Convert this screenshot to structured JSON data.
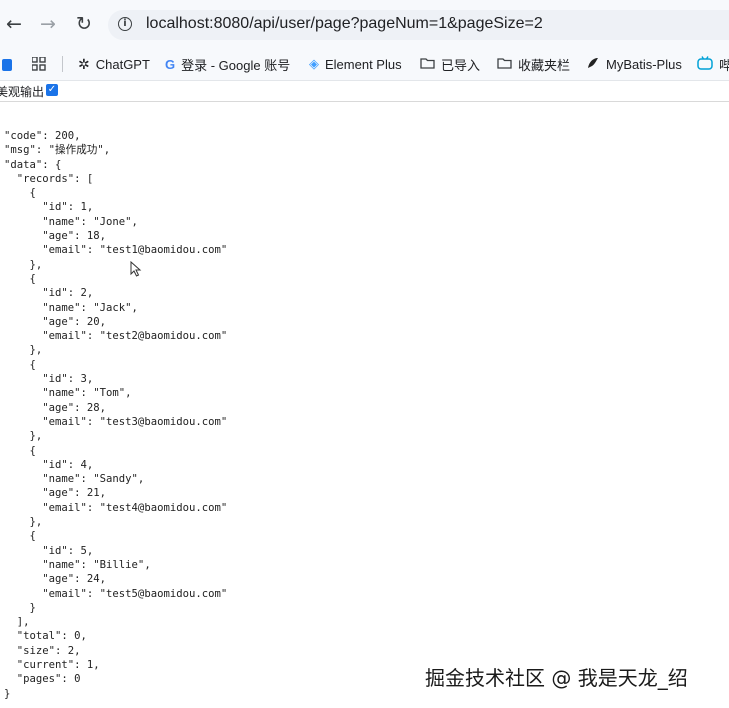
{
  "browser": {
    "url": "localhost:8080/api/user/page?pageNum=1&pageSize=2",
    "back_icon": "←",
    "forward_icon": "→",
    "reload_icon": "↻",
    "info_icon": "i"
  },
  "bookmarks": [
    {
      "label": "ChatGPT",
      "icon": "✲"
    },
    {
      "label": "登录 - Google 账号",
      "icon": "G"
    },
    {
      "label": "Element Plus",
      "icon": "◈"
    },
    {
      "label": "已导入",
      "icon": "folder"
    },
    {
      "label": "收藏夹栏",
      "icon": "folder"
    },
    {
      "label": "MyBatis-Plus",
      "icon": "bird"
    },
    {
      "label": "哔",
      "icon": "tv"
    }
  ],
  "pretty_print": {
    "label": "美观输出",
    "checked": "✓"
  },
  "json_lines": [
    "\"code\": 200,",
    "\"msg\": \"操作成功\",",
    "\"data\": {",
    "  \"records\": [",
    "    {",
    "      \"id\": 1,",
    "      \"name\": \"Jone\",",
    "      \"age\": 18,",
    "      \"email\": \"test1@baomidou.com\"",
    "    },",
    "    {",
    "      \"id\": 2,",
    "      \"name\": \"Jack\",",
    "      \"age\": 20,",
    "      \"email\": \"test2@baomidou.com\"",
    "    },",
    "    {",
    "      \"id\": 3,",
    "      \"name\": \"Tom\",",
    "      \"age\": 28,",
    "      \"email\": \"test3@baomidou.com\"",
    "    },",
    "    {",
    "      \"id\": 4,",
    "      \"name\": \"Sandy\",",
    "      \"age\": 21,",
    "      \"email\": \"test4@baomidou.com\"",
    "    },",
    "    {",
    "      \"id\": 5,",
    "      \"name\": \"Billie\",",
    "      \"age\": 24,",
    "      \"email\": \"test5@baomidou.com\"",
    "    }",
    "  ],",
    "  \"total\": 0,",
    "  \"size\": 2,",
    "  \"current\": 1,",
    "  \"pages\": 0",
    "}"
  ],
  "watermark": "掘金技术社区 @ 我是天龙_绍"
}
